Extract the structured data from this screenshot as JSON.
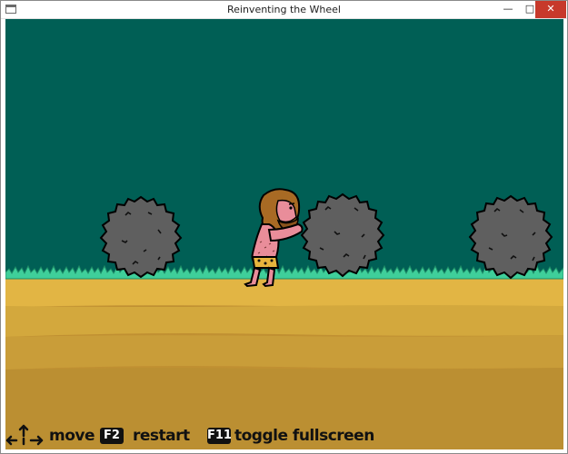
{
  "window": {
    "title": "Reinventing the Wheel",
    "controls": [
      "minimize",
      "maximize",
      "close"
    ],
    "close_color": "#c7392b"
  },
  "scene": {
    "sky_color": "#005f55",
    "grass_color": "#3fcf9a",
    "ground_color": "#d8a93a",
    "boulder_color": "#5f5f5f",
    "icons": [
      "boulder",
      "caveman",
      "boulder",
      "boulder"
    ]
  },
  "hud": {
    "arrow_keys_icon": "arrow-keys-icon",
    "move_label": "move",
    "restart_key": "F2",
    "restart_label": "restart",
    "fullscreen_key": "F11",
    "fullscreen_label": "toggle fullscreen"
  }
}
